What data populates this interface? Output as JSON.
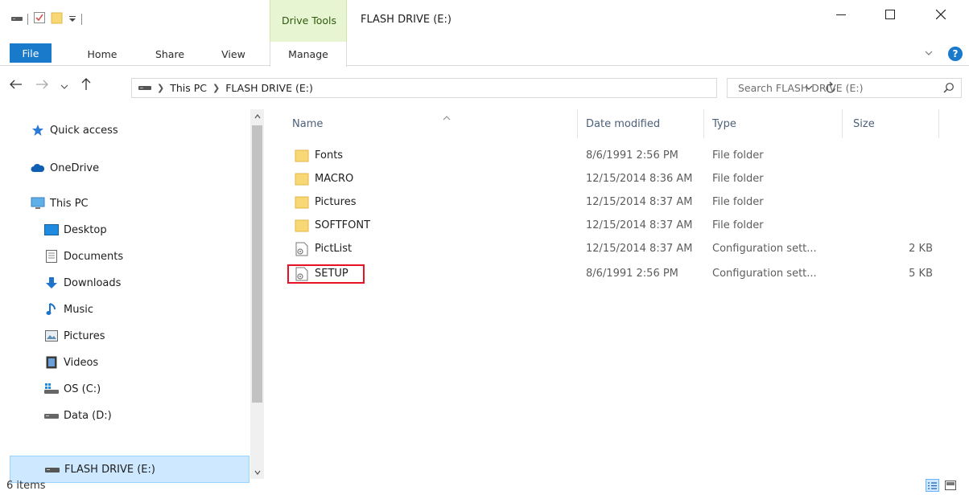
{
  "window": {
    "title": "FLASH DRIVE (E:)",
    "context_group": "Drive Tools"
  },
  "colors": {
    "accent": "#1979ca",
    "selection": "#cde8ff",
    "folder": "#f8d775",
    "highlight": "#e81123",
    "context_band": "#e8f5d2"
  },
  "ribbon": {
    "tabs": [
      {
        "label": "File"
      },
      {
        "label": "Home"
      },
      {
        "label": "Share"
      },
      {
        "label": "View"
      },
      {
        "label": "Manage"
      }
    ]
  },
  "address": {
    "crumbs": [
      "This PC",
      "FLASH DRIVE (E:)"
    ],
    "search_placeholder": "Search FLASH DRIVE (E:)"
  },
  "nav": {
    "items": [
      {
        "label": "Quick access",
        "icon": "star-icon"
      },
      {
        "label": "OneDrive",
        "icon": "cloud-icon"
      },
      {
        "label": "This PC",
        "icon": "computer-icon"
      },
      {
        "label": "Desktop",
        "icon": "desktop-icon"
      },
      {
        "label": "Documents",
        "icon": "documents-icon"
      },
      {
        "label": "Downloads",
        "icon": "download-icon"
      },
      {
        "label": "Music",
        "icon": "music-icon"
      },
      {
        "label": "Pictures",
        "icon": "pictures-icon"
      },
      {
        "label": "Videos",
        "icon": "videos-icon"
      },
      {
        "label": "OS (C:)",
        "icon": "windows-drive-icon"
      },
      {
        "label": "Data (D:)",
        "icon": "drive-icon"
      },
      {
        "label": "FLASH DRIVE (E:)",
        "icon": "usb-drive-icon"
      }
    ]
  },
  "files": {
    "columns": [
      "Name",
      "Date modified",
      "Type",
      "Size"
    ],
    "rows": [
      {
        "name": "Fonts",
        "date": "8/6/1991 2:56 PM",
        "type": "File folder",
        "size": "",
        "icon": "folder-icon"
      },
      {
        "name": "MACRO",
        "date": "12/15/2014 8:36 AM",
        "type": "File folder",
        "size": "",
        "icon": "folder-icon"
      },
      {
        "name": "Pictures",
        "date": "12/15/2014 8:37 AM",
        "type": "File folder",
        "size": "",
        "icon": "folder-icon"
      },
      {
        "name": "SOFTFONT",
        "date": "12/15/2014 8:37 AM",
        "type": "File folder",
        "size": "",
        "icon": "folder-icon"
      },
      {
        "name": "PictList",
        "date": "12/15/2014 8:37 AM",
        "type": "Configuration sett...",
        "size": "2 KB",
        "icon": "config-file-icon"
      },
      {
        "name": "SETUP",
        "date": "8/6/1991 2:56 PM",
        "type": "Configuration sett...",
        "size": "5 KB",
        "icon": "config-file-icon"
      }
    ]
  },
  "status": {
    "item_count": "6 items"
  }
}
